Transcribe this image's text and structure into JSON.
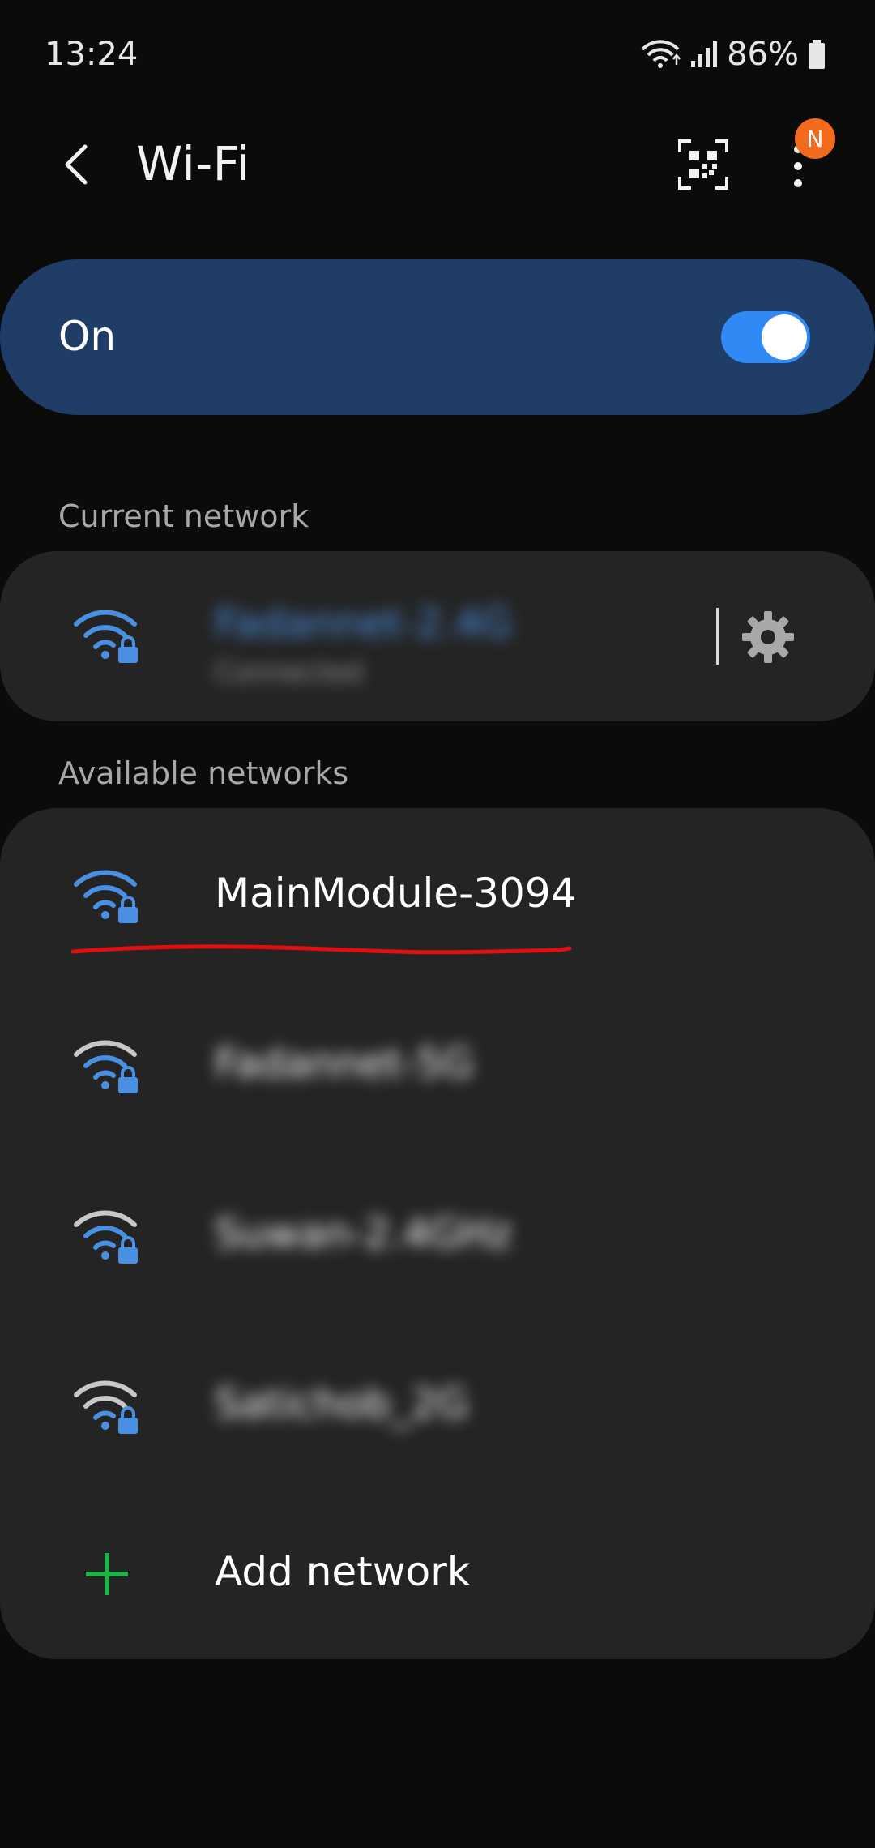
{
  "status_bar": {
    "time": "13:24",
    "battery": "86%",
    "icons": [
      "wifi-data-icon",
      "signal-icon",
      "battery-icon"
    ]
  },
  "app_bar": {
    "title": "Wi-Fi",
    "back_icon": "back-arrow-icon",
    "qr_icon": "qr-code-icon",
    "more_icon": "more-vertical-icon",
    "badge": "N"
  },
  "wifi_toggle": {
    "label": "On",
    "state": true
  },
  "current_network": {
    "section_label": "Current network",
    "name": "Fadannet-2.4G",
    "status": "Connected",
    "settings_icon": "gear-icon"
  },
  "available_networks": {
    "section_label": "Available networks",
    "items": [
      {
        "name": "MainModule-3094",
        "signal": "strong",
        "secured": true,
        "blurred": false
      },
      {
        "name": "Fadannet-5G",
        "signal": "medium",
        "secured": true,
        "blurred": true
      },
      {
        "name": "Suwan-2.4GHz",
        "signal": "medium",
        "secured": true,
        "blurred": true
      },
      {
        "name": "Satichob_2G",
        "signal": "medium",
        "secured": true,
        "blurred": true
      }
    ],
    "add_label": "Add network"
  },
  "colors": {
    "background": "#0b0b0b",
    "toggle_card": "#1f3d66",
    "switch_on": "#2f8af5",
    "card": "#242424",
    "wifi_blue": "#4a90e2",
    "add_green": "#1fb34a",
    "badge": "#f26b1d",
    "annotation_red": "#e01010"
  }
}
